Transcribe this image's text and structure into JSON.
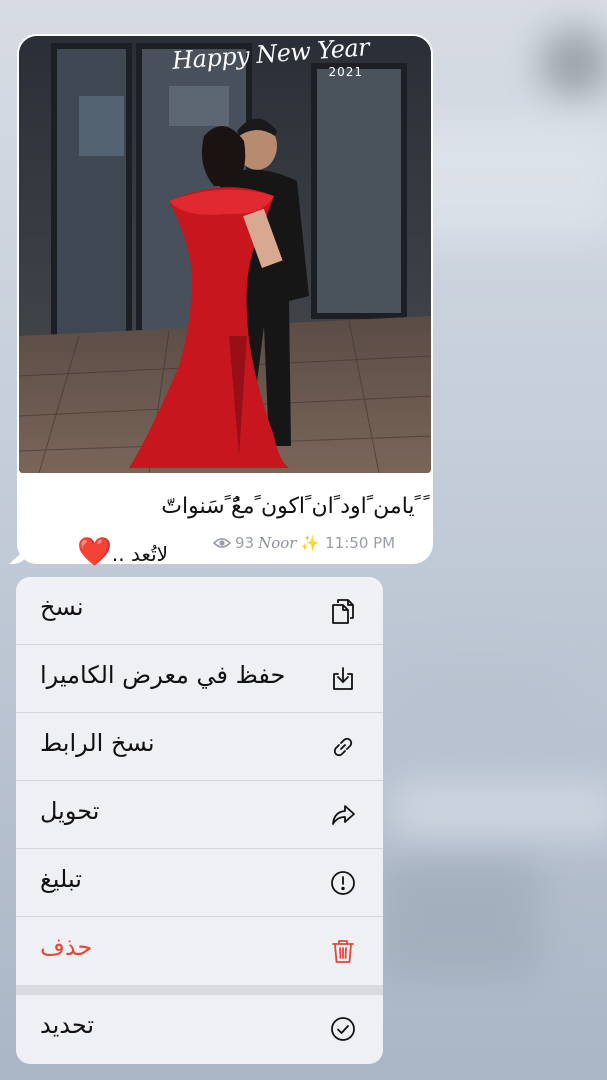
{
  "message": {
    "photo_overlay_title": "Happy New Year",
    "photo_overlay_year": "2021",
    "caption_line1": "ً ًيامن ًاود ًان ًاكون ًمعًٌ ًسَنواتّ",
    "caption_line2": "لاتُعد ..",
    "heart": "❤️",
    "views": "93",
    "author": "Noor",
    "sparkle": "✨",
    "time": "11:50 PM"
  },
  "menu": {
    "items": [
      {
        "label": "نسخ",
        "icon": "copy-icon"
      },
      {
        "label": "حفظ في معرض الكاميرا",
        "icon": "save-to-gallery-icon"
      },
      {
        "label": "نسخ الرابط",
        "icon": "link-icon"
      },
      {
        "label": "تحويل",
        "icon": "forward-icon"
      },
      {
        "label": "تبليغ",
        "icon": "report-icon"
      },
      {
        "label": "حذف",
        "icon": "trash-icon"
      },
      {
        "label": "تحديد",
        "icon": "select-check-icon"
      }
    ],
    "danger_color": "#e6453a"
  }
}
